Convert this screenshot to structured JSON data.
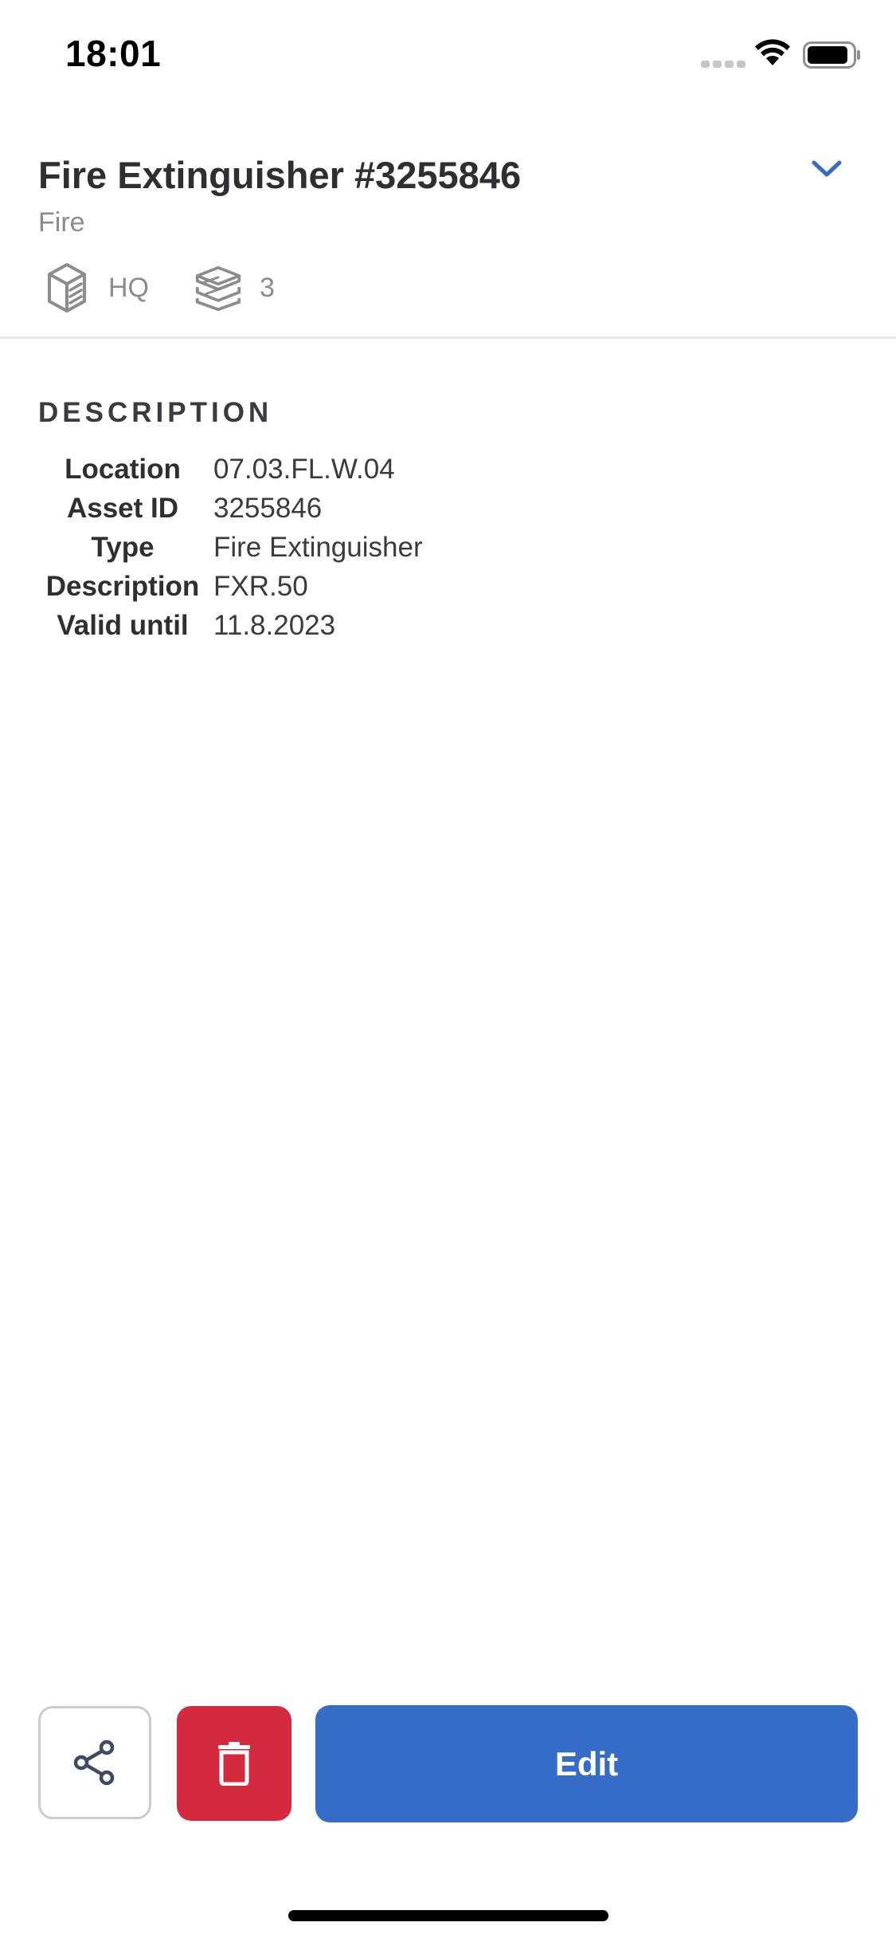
{
  "status_bar": {
    "time": "18:01"
  },
  "header": {
    "title": "Fire Extinguisher #3255846",
    "category": "Fire",
    "building": {
      "icon": "building-icon",
      "label": "HQ"
    },
    "floor": {
      "icon": "layers-icon",
      "label": "3"
    },
    "collapse_icon": "chevron-down-icon"
  },
  "description": {
    "heading": "DESCRIPTION",
    "rows": [
      {
        "label": "Location",
        "value": "07.03.FL.W.04"
      },
      {
        "label": "Asset ID",
        "value": "3255846"
      },
      {
        "label": "Type",
        "value": "Fire Extinguisher"
      },
      {
        "label": "Description",
        "value": "FXR.50"
      },
      {
        "label": "Valid until",
        "value": "11.8.2023"
      }
    ]
  },
  "actions": {
    "share_icon": "share-icon",
    "delete_icon": "trash-icon",
    "edit_label": "Edit"
  },
  "colors": {
    "accent": "#346cc8",
    "danger": "#d42a3f",
    "muted_text": "#8b8b90"
  }
}
